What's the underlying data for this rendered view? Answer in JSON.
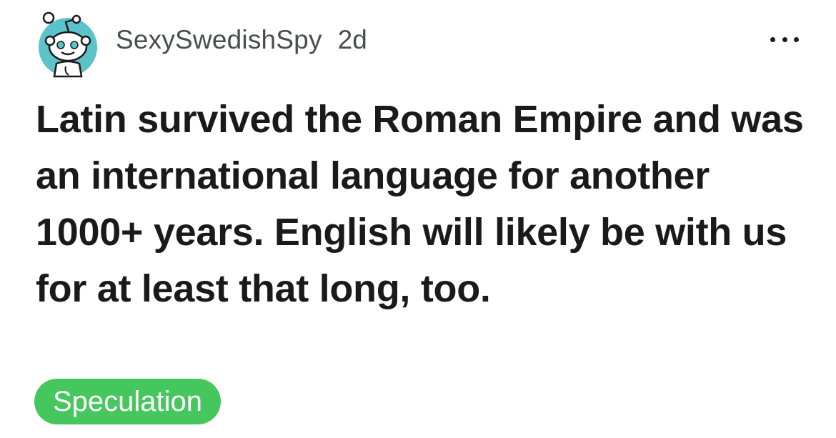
{
  "post": {
    "author": "SexySwedishSpy",
    "age": "2d",
    "title": "Latin survived the Roman Empire and was an international language for another 1000+ years. English will likely be with us for at least that long, too.",
    "flair": "Speculation"
  },
  "icons": {
    "avatar": "snoo-avatar-icon",
    "more": "more-options-icon"
  },
  "colors": {
    "avatar_bg": "#5bc3c9",
    "flair_bg": "#46c75d",
    "text": "#1a1a1b",
    "meta_text": "#4a4d50"
  }
}
